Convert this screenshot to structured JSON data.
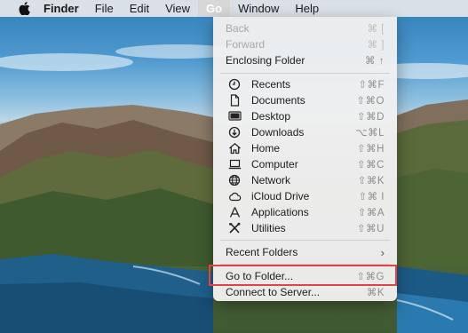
{
  "menubar": {
    "apple_icon": "apple-logo-icon",
    "items": [
      {
        "label": "Finder"
      },
      {
        "label": "File"
      },
      {
        "label": "Edit"
      },
      {
        "label": "View"
      },
      {
        "label": "Go"
      },
      {
        "label": "Window"
      },
      {
        "label": "Help"
      }
    ]
  },
  "go_menu": {
    "nav": [
      {
        "label": "Back",
        "shortcut": "⌘ [",
        "enabled": false
      },
      {
        "label": "Forward",
        "shortcut": "⌘ ]",
        "enabled": false
      },
      {
        "label": "Enclosing Folder",
        "shortcut": "⌘ ↑",
        "enabled": true
      }
    ],
    "places": [
      {
        "label": "Recents",
        "shortcut": "⇧⌘F",
        "icon": "clock-icon"
      },
      {
        "label": "Documents",
        "shortcut": "⇧⌘O",
        "icon": "document-icon"
      },
      {
        "label": "Desktop",
        "shortcut": "⇧⌘D",
        "icon": "desktop-icon"
      },
      {
        "label": "Downloads",
        "shortcut": "⌥⌘L",
        "icon": "download-icon"
      },
      {
        "label": "Home",
        "shortcut": "⇧⌘H",
        "icon": "home-icon"
      },
      {
        "label": "Computer",
        "shortcut": "⇧⌘C",
        "icon": "laptop-icon"
      },
      {
        "label": "Network",
        "shortcut": "⇧⌘K",
        "icon": "globe-icon"
      },
      {
        "label": "iCloud Drive",
        "shortcut": "⇧⌘ I",
        "icon": "cloud-icon"
      },
      {
        "label": "Applications",
        "shortcut": "⇧⌘A",
        "icon": "applications-icon"
      },
      {
        "label": "Utilities",
        "shortcut": "⇧⌘U",
        "icon": "tools-icon"
      }
    ],
    "recent_folders": {
      "label": "Recent Folders",
      "icon": "chevron-right-icon",
      "chevron": "›"
    },
    "go_to_folder": {
      "label": "Go to Folder...",
      "shortcut": "⇧⌘G"
    },
    "connect_to_server": {
      "label": "Connect to Server...",
      "shortcut": "⌘K"
    }
  },
  "colors": {
    "highlight_border": "#e0424a",
    "active_menu_bg": "#d7d7d7"
  }
}
